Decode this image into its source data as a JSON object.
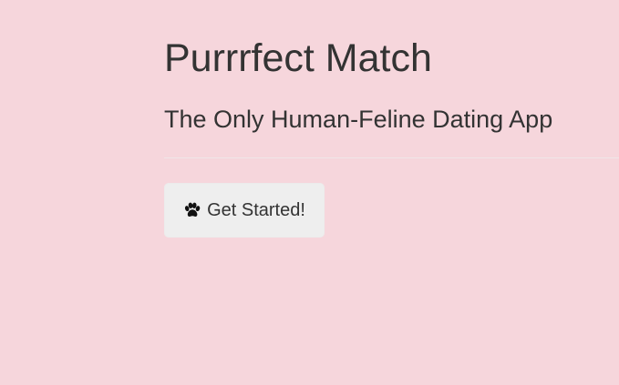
{
  "page": {
    "title": "Purrrfect Match",
    "subtitle": "The Only Human-Feline Dating App"
  },
  "cta": {
    "label": "Get Started!",
    "icon": "paw-icon"
  },
  "colors": {
    "background": "#f6d6dc",
    "text": "#333333",
    "button_background": "#eeeeee",
    "divider": "#efe6e8"
  }
}
